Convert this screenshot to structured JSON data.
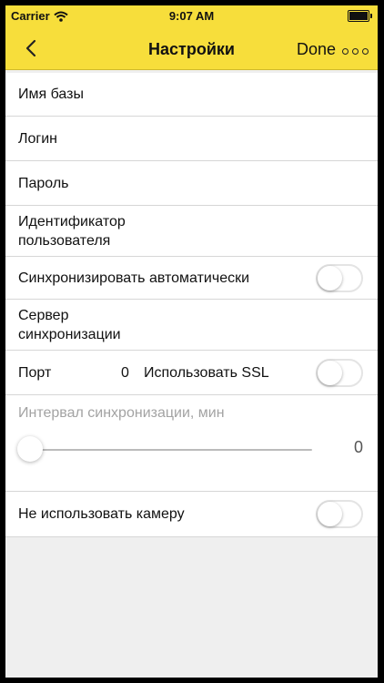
{
  "status_bar": {
    "carrier": "Carrier",
    "time": "9:07 AM"
  },
  "nav": {
    "back_icon": "chevron-left-icon",
    "title": "Настройки",
    "done_label": "Done",
    "more_icon": "more-dots-icon"
  },
  "settings": {
    "db_name_label": "Имя базы",
    "login_label": "Логин",
    "password_label": "Пароль",
    "user_id_line1": "Идентификатор",
    "user_id_line2": "пользователя",
    "auto_sync_label": "Синхронизировать автоматически",
    "auto_sync_on": false,
    "sync_server_line1": "Сервер",
    "sync_server_line2": "синхронизации",
    "port_label": "Порт",
    "port_value": "0",
    "use_ssl_label": "Использовать SSL",
    "use_ssl_on": false,
    "sync_interval_label": "Интервал синхронизации, мин",
    "sync_interval_value": "0",
    "sync_interval_fraction": 0,
    "no_camera_label": "Не использовать камеру",
    "no_camera_on": false
  },
  "colors": {
    "header": "#f7de3b",
    "background": "#efefef",
    "muted_text": "#a3a3a3"
  }
}
